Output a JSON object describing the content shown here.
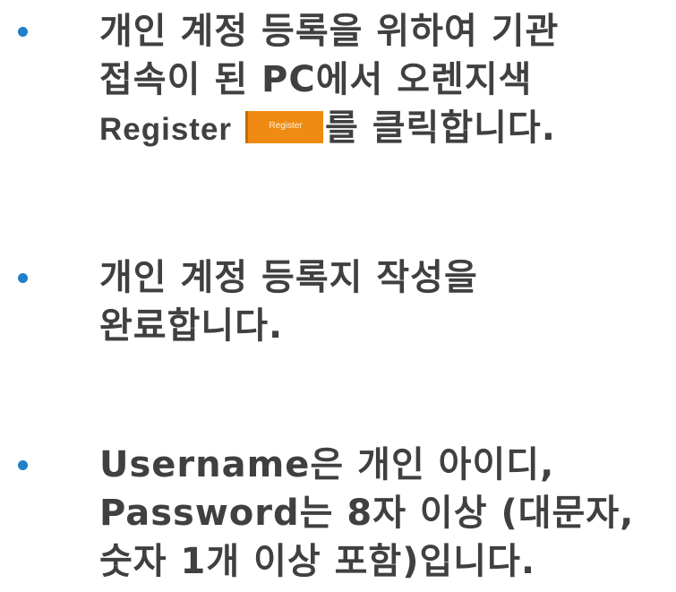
{
  "bullets": [
    {
      "lines": [
        "개인 계정 등록을 위하여 기관",
        "접속이 된 PC에서 오렌지색"
      ],
      "line3_prefix": "Register",
      "register_button_label": "Register",
      "line3_suffix": "를 클릭합니다."
    },
    {
      "lines": [
        "개인 계정 등록지 작성을",
        "완료합니다."
      ]
    },
    {
      "lines": [
        "Username은 개인 아이디,",
        "Password는 8자 이상 (대문자,",
        "숫자 1개 이상 포함)입니다."
      ]
    }
  ],
  "colors": {
    "bullet": "#1f7fc9",
    "text": "#404040",
    "register_button": "#ef8a12"
  }
}
